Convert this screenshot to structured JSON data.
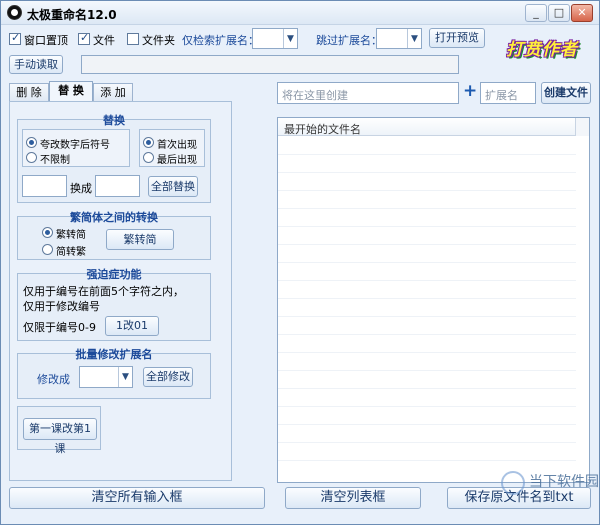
{
  "window": {
    "title": "太极重命名12.0",
    "controls": [
      "minimize-icon",
      "maximize-icon",
      "close-icon"
    ]
  },
  "toolbar": {
    "always_on_top": {
      "label": "窗口置顶",
      "checked": true
    },
    "files": {
      "label": "文件",
      "checked": true
    },
    "folders": {
      "label": "文件夹",
      "checked": false
    },
    "search_ext_label": "仅检索扩展名：",
    "skip_ext_label": "跳过扩展名：",
    "open_preview": "打开预览",
    "manual_read": "手动读取",
    "logo": "打贲作者"
  },
  "tabs": [
    {
      "label": "删 除",
      "active": false
    },
    {
      "label": "替 换",
      "active": true
    },
    {
      "label": "添 加",
      "active": false
    }
  ],
  "replace_group": {
    "title": "替换",
    "opt_change_suffix_num": "夸改数字后符号",
    "opt_unlimited": "不限制",
    "opt_first": "首次出现",
    "opt_last": "最后出现",
    "replace_with": "换成",
    "replace_all": "全部替换"
  },
  "convert_group": {
    "title": "繁简体之间的转换",
    "opt_trad_to_simp": "繁转简",
    "opt_simp_to_trad": "简转繁",
    "button": "繁转简"
  },
  "ocd_group": {
    "title": "强迫症功能",
    "line1": "仅用于编号在前面5个字符之内，",
    "line2": "仅用于修改编号",
    "limit_label": "仅限于编号0-9",
    "button": "1改01"
  },
  "ext_group": {
    "title": "批量修改扩展名",
    "label": "修改成",
    "button": "全部修改"
  },
  "lesson_button": "第一课改第1课",
  "right": {
    "create_placeholder": "将在这里创建",
    "ext_placeholder": "扩展名",
    "create_button": "创建文件",
    "plus": "+",
    "list_header": "最开始的文件名"
  },
  "bottom": {
    "clear_inputs": "清空所有输入框",
    "clear_list": "清空列表框",
    "save_names": "保存原文件名到txt"
  },
  "watermark": "当下软件园"
}
